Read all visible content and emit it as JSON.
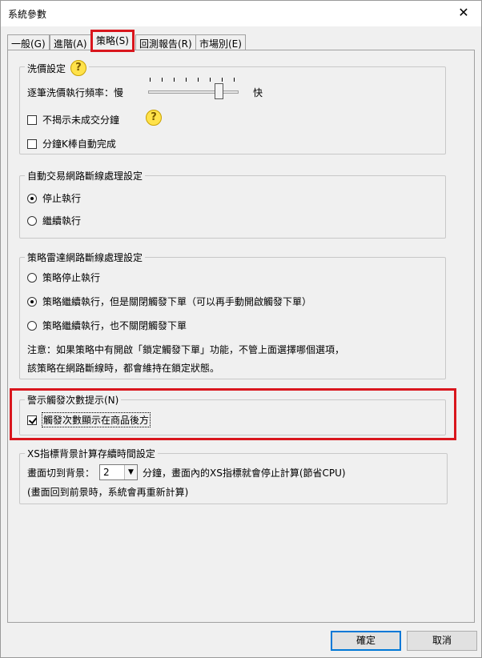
{
  "window": {
    "title": "系統參數",
    "close_glyph": "✕"
  },
  "tabs": [
    {
      "label": "一般(G)"
    },
    {
      "label": "進階(A)"
    },
    {
      "label": "策略(S)",
      "active": true
    },
    {
      "label": "回測報告(R)"
    },
    {
      "label": "市場別(E)"
    }
  ],
  "wash_price": {
    "title": "洗價設定",
    "help_glyph": "?",
    "freq_label": "逐筆洗價執行頻率：慢",
    "freq_fast": "快",
    "freq_level_fraction": 0.8,
    "hide_unfilled_label": "不揭示未成交分鐘",
    "hide_unfilled_checked": false,
    "auto_complete_label": "分鐘K棒自動完成",
    "auto_complete_checked": false
  },
  "auto_trade": {
    "title": "自動交易網路斷線處理設定",
    "options": [
      {
        "label": "停止執行",
        "checked": true
      },
      {
        "label": "繼續執行",
        "checked": false
      }
    ]
  },
  "strategy_radar": {
    "title": "策略雷達網路斷線處理設定",
    "options": [
      {
        "label": "策略停止執行",
        "checked": false
      },
      {
        "label": "策略繼續執行，但是關閉觸發下單（可以再手動開啟觸發下單）",
        "checked": true
      },
      {
        "label": "策略繼續執行，也不關閉觸發下單",
        "checked": false
      }
    ],
    "note_line1": "注意：如果策略中有開啟「鎖定觸發下單」功能，不管上面選擇哪個選項，",
    "note_line2": "該策略在網路斷線時，都會維持在鎖定狀態。"
  },
  "alert_trigger": {
    "title": "警示觸發次數提示(N)",
    "show_count_label": "觸發次數顯示在商品後方",
    "show_count_checked": true
  },
  "xs_background": {
    "title": "XS指標背景計算存續時間設定",
    "prefix": "畫面切到背景：",
    "minutes_value": "2",
    "dropdown_glyph": "▼",
    "suffix": "分鐘，畫面內的XS指標就會停止計算(節省CPU)",
    "note": "(畫面回到前景時，系統會再重新計算)"
  },
  "buttons": {
    "ok": "確定",
    "cancel": "取消"
  }
}
